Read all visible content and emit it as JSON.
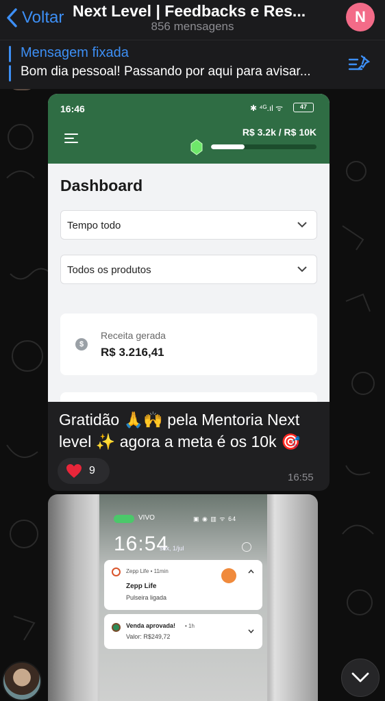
{
  "header": {
    "back_label": "Voltar",
    "title": "Next Level | Feedbacks e Res...",
    "subtitle": "856 mensagens",
    "avatar_letter": "N",
    "avatar_color": "#f36b88"
  },
  "pinned": {
    "title": "Mensagem fixada",
    "text": "Bom dia pessoal! Passando por aqui para avisar..."
  },
  "message1": {
    "screenshot": {
      "status_time": "16:46",
      "status_icons": "✱ ⁴ᴳ.ıl ᯤ",
      "battery": "47",
      "goal_text": "R$ 3.2k / R$ 10K",
      "goal_progress": 0.32,
      "dashboard_title": "Dashboard",
      "filter_period": "Tempo todo",
      "filter_products": "Todos os produtos",
      "revenue_label": "Receita gerada",
      "revenue_value": "R$ 3.216,41",
      "accent_color": "#2f6d44"
    },
    "caption": "Gratidão 🙏🙌 pela Mentoria Next level ✨ agora a meta é os 10k 🎯",
    "reaction_emoji": "heart",
    "reaction_count": "9",
    "time": "16:55"
  },
  "message2": {
    "lockscreen": {
      "carrier": "VIVO",
      "status_icons": "▣ ◉ ▥ ᯤ 64",
      "clock": "16:54",
      "date": "sex, 1/jul",
      "notif1_meta": "Zepp Life • 11min",
      "notif1_title": "Zepp Life",
      "notif1_body": "Pulseira ligada",
      "notif2_title": "Venda aprovada!",
      "notif2_meta": "• 1h",
      "notif2_body": "Valor: R$249,72"
    }
  }
}
